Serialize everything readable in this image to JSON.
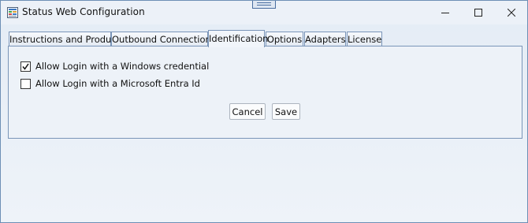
{
  "window": {
    "title": "Status Web Configuration",
    "controls": {
      "minimize": "minimize-icon",
      "maximize": "maximize-icon",
      "close": "close-icon"
    }
  },
  "tabs": [
    {
      "label": "Instructions and Product",
      "active": false
    },
    {
      "label": "Outbound Connections",
      "active": false
    },
    {
      "label": "Identification",
      "active": true
    },
    {
      "label": "Options",
      "active": false
    },
    {
      "label": "Adapters",
      "active": false
    },
    {
      "label": "License",
      "active": false
    }
  ],
  "identification": {
    "options": [
      {
        "label": "Allow Login with a Windows credential",
        "checked": true
      },
      {
        "label": "Allow Login with a Microsoft Entra Id",
        "checked": false
      }
    ],
    "cancel_label": "Cancel",
    "save_label": "Save"
  },
  "colors": {
    "accent_border": "#7a95b8",
    "window_border": "#6d8fb5",
    "background": "#e9f0f8"
  }
}
